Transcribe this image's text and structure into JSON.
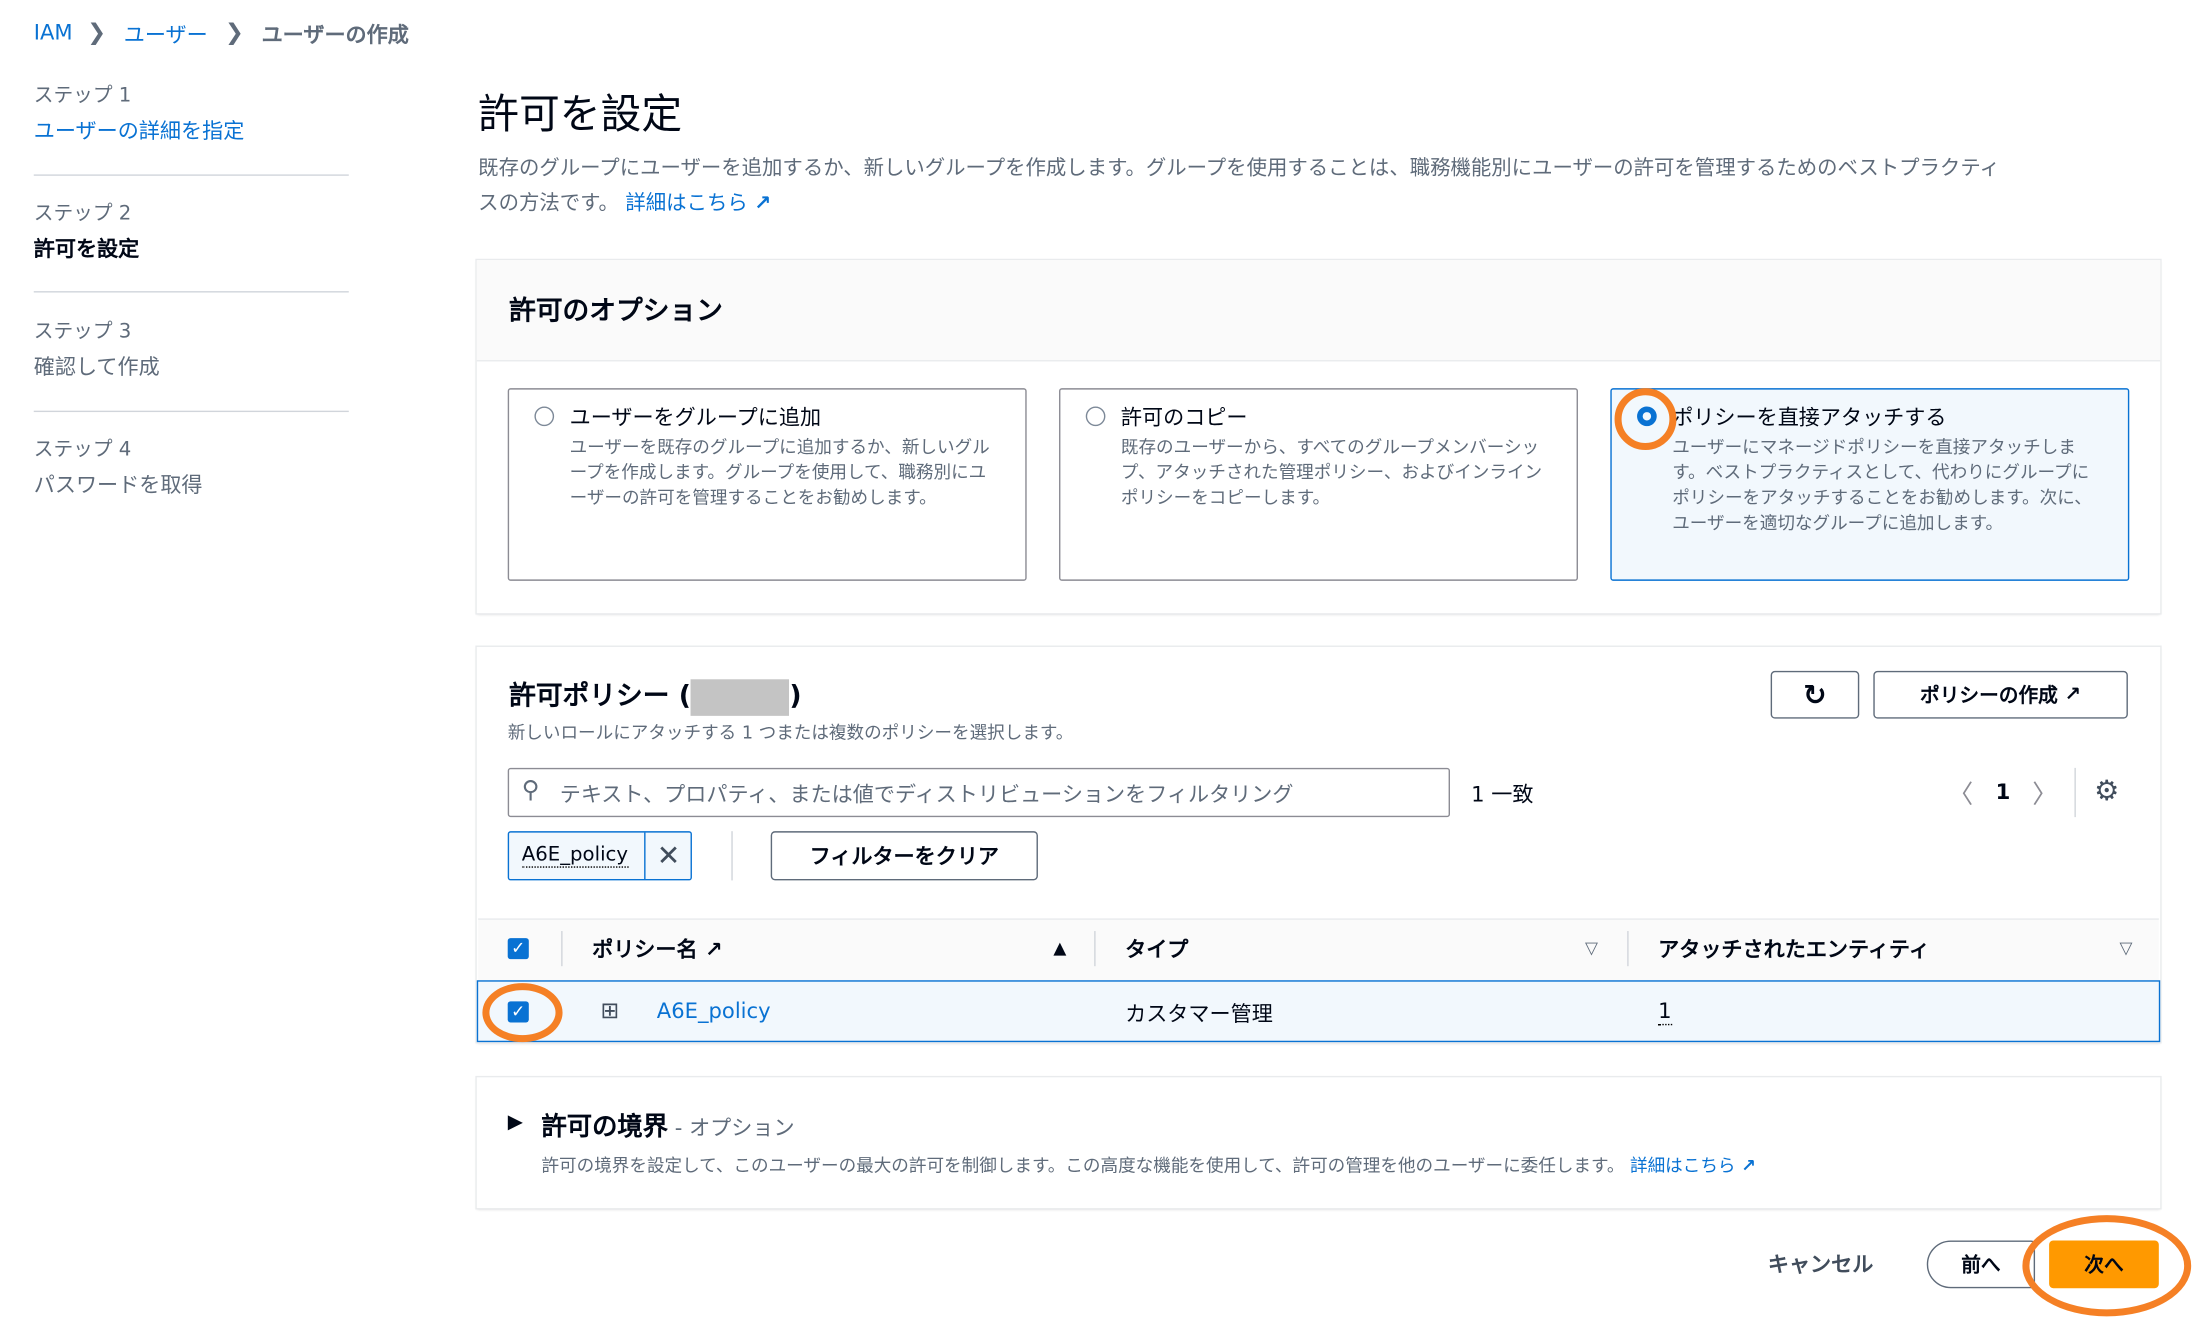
{
  "breadcrumb": [
    "IAM",
    "ユーザー",
    "ユーザーの作成"
  ],
  "steps": [
    {
      "label": "ステップ 1",
      "title": "ユーザーの詳細を指定"
    },
    {
      "label": "ステップ 2",
      "title": "許可を設定"
    },
    {
      "label": "ステップ 3",
      "title": "確認して作成"
    },
    {
      "label": "ステップ 4",
      "title": "パスワードを取得"
    }
  ],
  "page": {
    "title": "許可を設定",
    "desc_line1": "既存のグループにユーザーを追加するか、新しいグループを作成します。グループを使用することは、職務機能別にユーザーの許可を管理するためのベストプラクティ",
    "desc_line2": "スの方法です。",
    "learn_more": "詳細はこちら"
  },
  "options": {
    "title": "許可のオプション",
    "cards": [
      {
        "title": "ユーザーをグループに追加",
        "desc": "ユーザーを既存のグループに追加するか、新しいグループを作成します。グループを使用して、職務別にユーザーの許可を管理することをお勧めします。",
        "selected": false
      },
      {
        "title": "許可のコピー",
        "desc": "既存のユーザーから、すべてのグループメンバーシップ、アタッチされた管理ポリシー、およびインラインポリシーをコピーします。",
        "selected": false
      },
      {
        "title": "ポリシーを直接アタッチする",
        "desc": "ユーザーにマネージドポリシーを直接アタッチします。ベストプラクティスとして、代わりにグループにポリシーをアタッチすることをお勧めします。次に、ユーザーを適切なグループに追加します。",
        "selected": true
      }
    ]
  },
  "policies": {
    "title": "許可ポリシー (",
    "title_end": ")",
    "subtitle": "新しいロールにアタッチする 1 つまたは複数のポリシーを選択します。",
    "create_label": "ポリシーの作成",
    "search_placeholder": "テキスト、プロパティ、または値でディストリビューションをフィルタリング",
    "match_count": "1 一致",
    "page": "1",
    "token": "A6E_policy",
    "clear_label": "フィルターをクリア",
    "columns": [
      "ポリシー名",
      "タイプ",
      "アタッチされたエンティティ"
    ],
    "rows": [
      {
        "name": "A6E_policy",
        "type": "カスタマー管理",
        "entities": "1",
        "checked": true
      }
    ]
  },
  "boundary": {
    "title": "許可の境界",
    "optional": " - オプション",
    "desc": "許可の境界を設定して、このユーザーの最大の許可を制御します。この高度な機能を使用して、許可の管理を他のユーザーに委任します。",
    "learn_more": "詳細はこちら"
  },
  "footer": {
    "cancel": "キャンセル",
    "prev": "前へ",
    "next": "次へ"
  },
  "colors": {
    "accent": "#0972d3",
    "primary": "#ff9900",
    "annotation": "#f58025"
  }
}
